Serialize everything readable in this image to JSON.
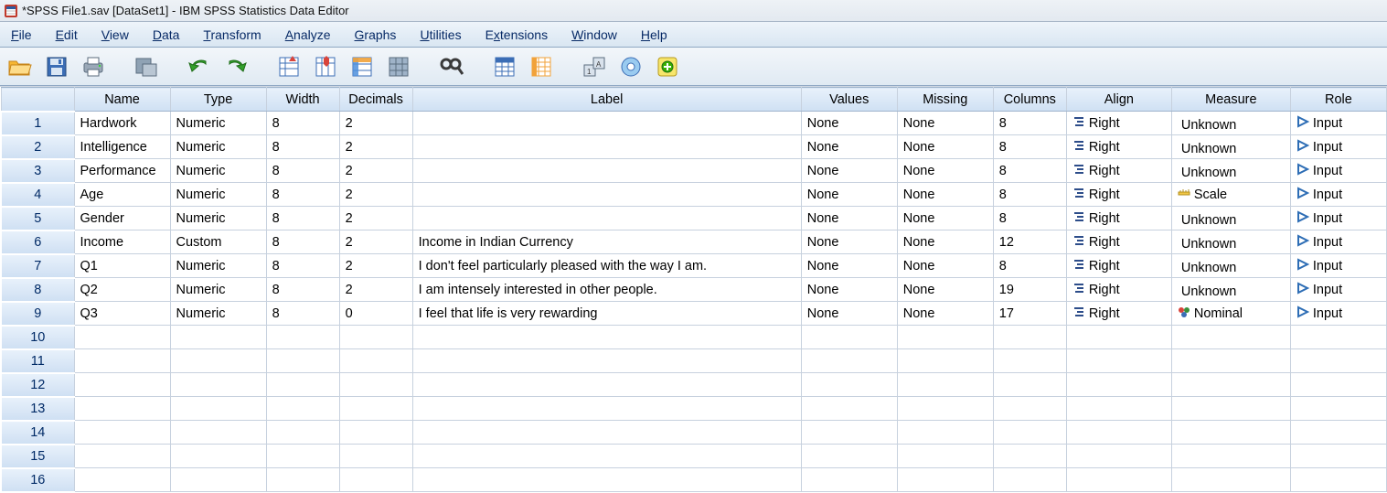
{
  "window": {
    "title": "*SPSS File1.sav [DataSet1] - IBM SPSS Statistics Data Editor"
  },
  "menu": {
    "items": [
      {
        "label": "File",
        "u": "F"
      },
      {
        "label": "Edit",
        "u": "E"
      },
      {
        "label": "View",
        "u": "V"
      },
      {
        "label": "Data",
        "u": "D"
      },
      {
        "label": "Transform",
        "u": "T"
      },
      {
        "label": "Analyze",
        "u": "A"
      },
      {
        "label": "Graphs",
        "u": "G"
      },
      {
        "label": "Utilities",
        "u": "U"
      },
      {
        "label": "Extensions",
        "u": "x"
      },
      {
        "label": "Window",
        "u": "W"
      },
      {
        "label": "Help",
        "u": "H"
      }
    ]
  },
  "headers": {
    "name": "Name",
    "type": "Type",
    "width": "Width",
    "decimals": "Decimals",
    "label": "Label",
    "values": "Values",
    "missing": "Missing",
    "columns": "Columns",
    "align": "Align",
    "measure": "Measure",
    "role": "Role"
  },
  "rows": [
    {
      "n": "1",
      "name": "Hardwork",
      "type": "Numeric",
      "width": "8",
      "decimals": "2",
      "label": "",
      "values": "None",
      "missing": "None",
      "columns": "8",
      "align": "Right",
      "measure": "Unknown",
      "role": "Input"
    },
    {
      "n": "2",
      "name": "Intelligence",
      "type": "Numeric",
      "width": "8",
      "decimals": "2",
      "label": "",
      "values": "None",
      "missing": "None",
      "columns": "8",
      "align": "Right",
      "measure": "Unknown",
      "role": "Input"
    },
    {
      "n": "3",
      "name": "Performance",
      "type": "Numeric",
      "width": "8",
      "decimals": "2",
      "label": "",
      "values": "None",
      "missing": "None",
      "columns": "8",
      "align": "Right",
      "measure": "Unknown",
      "role": "Input"
    },
    {
      "n": "4",
      "name": "Age",
      "type": "Numeric",
      "width": "8",
      "decimals": "2",
      "label": "",
      "values": "None",
      "missing": "None",
      "columns": "8",
      "align": "Right",
      "measure": "Scale",
      "role": "Input"
    },
    {
      "n": "5",
      "name": "Gender",
      "type": "Numeric",
      "width": "8",
      "decimals": "2",
      "label": "",
      "values": "None",
      "missing": "None",
      "columns": "8",
      "align": "Right",
      "measure": "Unknown",
      "role": "Input"
    },
    {
      "n": "6",
      "name": "Income",
      "type": "Custom",
      "width": "8",
      "decimals": "2",
      "label": "Income in Indian Currency",
      "values": "None",
      "missing": "None",
      "columns": "12",
      "align": "Right",
      "measure": "Unknown",
      "role": "Input"
    },
    {
      "n": "7",
      "name": "Q1",
      "type": "Numeric",
      "width": "8",
      "decimals": "2",
      "label": "I don't feel particularly pleased with the way I am.",
      "values": "None",
      "missing": "None",
      "columns": "8",
      "align": "Right",
      "measure": "Unknown",
      "role": "Input"
    },
    {
      "n": "8",
      "name": "Q2",
      "type": "Numeric",
      "width": "8",
      "decimals": "2",
      "label": "I am intensely interested in other people.",
      "values": "None",
      "missing": "None",
      "columns": "19",
      "align": "Right",
      "measure": "Unknown",
      "role": "Input"
    },
    {
      "n": "9",
      "name": "Q3",
      "type": "Numeric",
      "width": "8",
      "decimals": "0",
      "label": "I feel that life is very rewarding",
      "values": "None",
      "missing": "None",
      "columns": "17",
      "align": "Right",
      "measure": "Nominal",
      "role": "Input"
    }
  ],
  "empty_rows": [
    "10",
    "11",
    "12",
    "13",
    "14",
    "15",
    "16"
  ]
}
